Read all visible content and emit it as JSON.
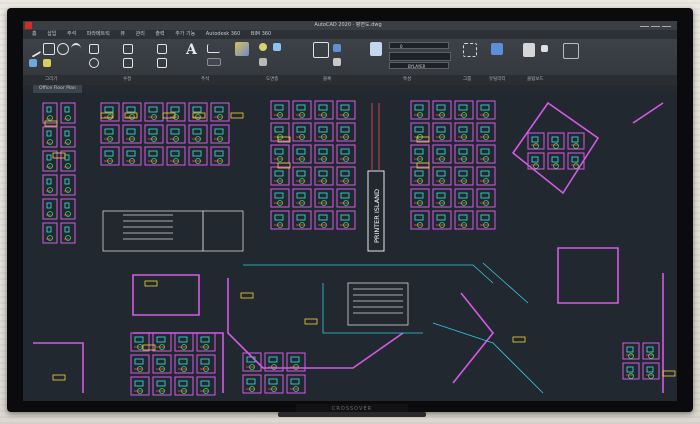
{
  "window": {
    "title": "AutoCAD 2020 · 평면도.dwg",
    "app_icon": "autocad-logo-icon"
  },
  "menu": [
    "홈",
    "삽입",
    "주석",
    "파라메트릭",
    "뷰",
    "관리",
    "출력",
    "추가 기능",
    "Autodesk 360",
    "BIM 360"
  ],
  "ribbon_panels": [
    "그리기",
    "수정",
    "주석",
    "도면층",
    "블록",
    "특성",
    "그룹",
    "유틸리티",
    "클립보드"
  ],
  "layer_field": "0",
  "bylayer_label": "BYLAYER",
  "doc_tab": "Office Floor Plan",
  "plan_labels": {
    "printer_island": "PRINTER ISLAND"
  },
  "brand": "CROSSOVER",
  "colors": {
    "cad_background": "#212830",
    "walls": "#d65ae6",
    "desks": "#38e6e8",
    "chairs": "#39e06a",
    "room_text": "#ff5959",
    "tags": "#f6d23a"
  }
}
